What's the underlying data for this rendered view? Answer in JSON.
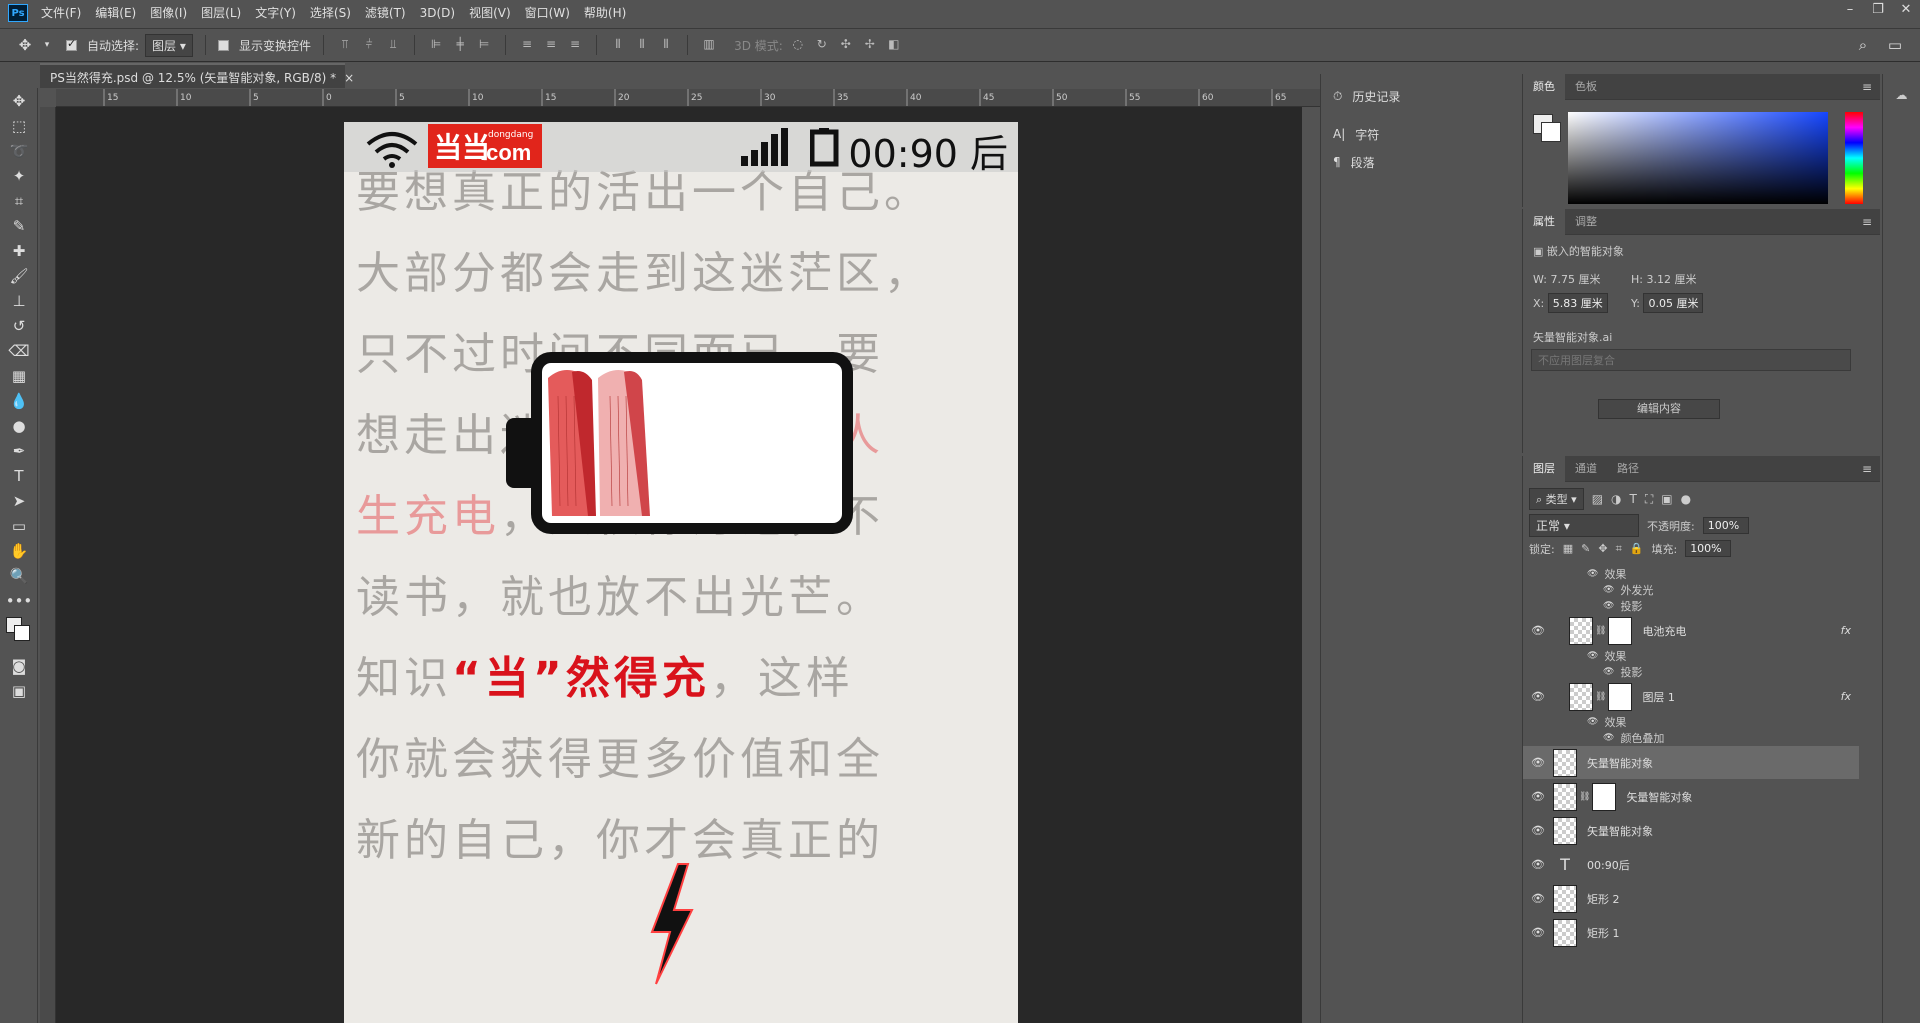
{
  "menubar": {
    "logo": "Ps",
    "items": [
      "文件(F)",
      "编辑(E)",
      "图像(I)",
      "图层(L)",
      "文字(Y)",
      "选择(S)",
      "滤镜(T)",
      "3D(D)",
      "视图(V)",
      "窗口(W)",
      "帮助(H)"
    ],
    "controls": [
      "–",
      "❐",
      "✕"
    ]
  },
  "options": {
    "auto_select_label": "自动选择:",
    "auto_select_value": "图层",
    "show_transform_label": "显示变换控件",
    "mode_3d_label": "3D 模式:"
  },
  "doc_tab": {
    "title": "PS当然得充.psd @ 12.5% (矢量智能对象, RGB/8) *",
    "close": "×"
  },
  "ruler": {
    "h_ticks": [
      "15",
      "10",
      "5",
      "0",
      "5",
      "10",
      "15",
      "20",
      "25",
      "30",
      "35",
      "40",
      "45",
      "50",
      "55",
      "60",
      "65"
    ]
  },
  "artwork": {
    "logo_cn": "当当",
    "logo_en": "dongdang",
    "logo_com": ".com",
    "clock": "00:90 后",
    "lines": [
      {
        "parts": [
          {
            "t": "要想真正的活出一个自己。",
            "c": ""
          }
        ]
      },
      {
        "parts": [
          {
            "t": "大部分都会走到这迷茫区，",
            "c": ""
          }
        ]
      },
      {
        "parts": [
          {
            "t": "只不过时间不同而已，要",
            "c": ""
          }
        ]
      },
      {
        "parts": [
          {
            "t": "想走出迷茫，",
            "c": ""
          },
          {
            "t": "读书就是人",
            "c": "red-light"
          }
        ]
      },
      {
        "parts": [
          {
            "t": "生充电",
            "c": "red-light"
          },
          {
            "t": "，人很像灯泡，不",
            "c": ""
          }
        ]
      },
      {
        "parts": [
          {
            "t": "读书，就也放不出光芒。",
            "c": ""
          }
        ]
      },
      {
        "parts": [
          {
            "t": "知识",
            "c": ""
          },
          {
            "t": "“当”然得充",
            "c": "red"
          },
          {
            "t": "，这样",
            "c": ""
          }
        ]
      },
      {
        "parts": [
          {
            "t": "你就会获得更多价值和全",
            "c": ""
          }
        ]
      },
      {
        "parts": [
          {
            "t": "新的自己，你才会真正的",
            "c": ""
          }
        ]
      }
    ]
  },
  "dock_left": {
    "history": "历史记录",
    "character": "字符",
    "paragraph": "段落"
  },
  "color_panel": {
    "tabs": [
      "颜色",
      "色板"
    ],
    "fg": "#eeeeee",
    "bg": "#ffffff"
  },
  "props": {
    "tabs": [
      "属性",
      "调整"
    ],
    "type": "嵌入的智能对象",
    "w_label": "W:",
    "w_value": "7.75 厘米",
    "h_label": "H:",
    "h_value": "3.12 厘米",
    "x_label": "X:",
    "x_value": "5.83 厘米",
    "y_label": "Y:",
    "y_value": "0.05 厘米",
    "filename": "矢量智能对象.ai",
    "comp_placeholder": "不应用图层复合",
    "edit_btn": "编辑内容"
  },
  "layers": {
    "tabs": [
      "图层",
      "通道",
      "路径"
    ],
    "filter": "类型",
    "blend": "正常",
    "opacity_label": "不透明度:",
    "opacity": "100%",
    "lock_label": "锁定:",
    "fill_label": "填充:",
    "fill": "100%",
    "rows": [
      {
        "name": "效果",
        "kind": "effect-head"
      },
      {
        "name": "外发光",
        "kind": "effect"
      },
      {
        "name": "投影",
        "kind": "effect"
      },
      {
        "name": "电池充电",
        "kind": "layer-mask",
        "fx": "fx"
      },
      {
        "name": "效果",
        "kind": "effect-head"
      },
      {
        "name": "投影",
        "kind": "effect"
      },
      {
        "name": "图层 1",
        "kind": "layer-mask",
        "fx": "fx"
      },
      {
        "name": "效果",
        "kind": "effect-head"
      },
      {
        "name": "颜色叠加",
        "kind": "effect"
      },
      {
        "name": "矢量智能对象",
        "kind": "layer",
        "selected": true
      },
      {
        "name": "矢量智能对象",
        "kind": "layer-mask"
      },
      {
        "name": "矢量智能对象",
        "kind": "layer"
      },
      {
        "name": "00:90后",
        "kind": "text"
      },
      {
        "name": "矩形 2",
        "kind": "layer"
      },
      {
        "name": "矩形 1",
        "kind": "layer"
      }
    ]
  }
}
